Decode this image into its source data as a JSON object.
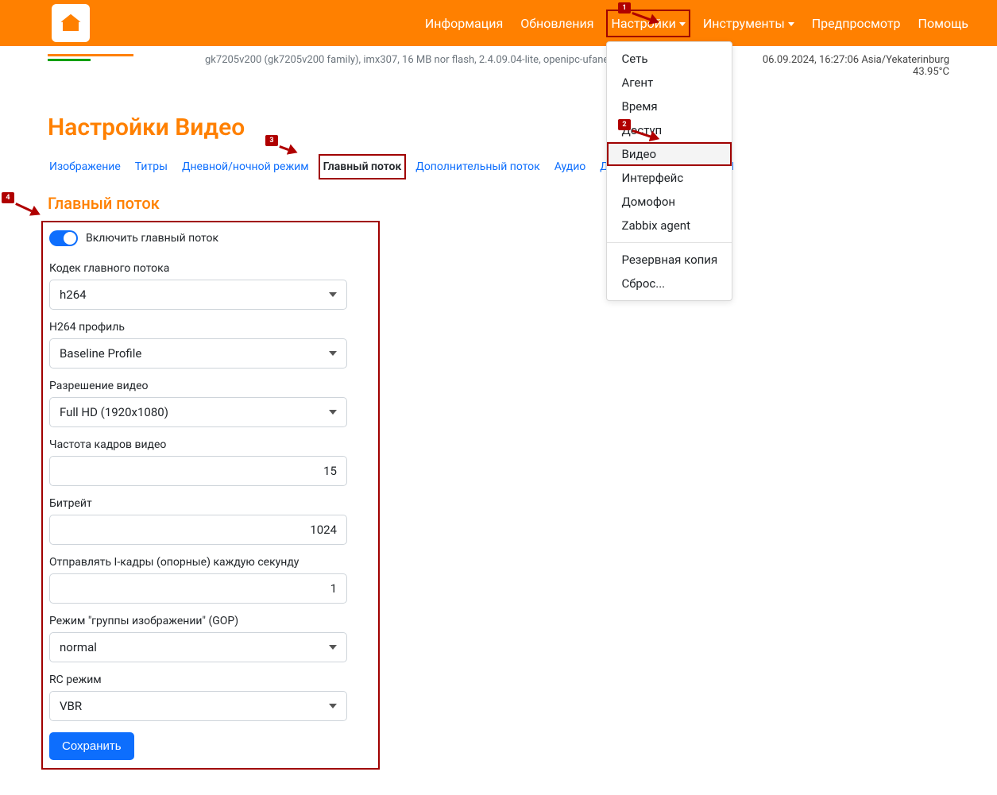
{
  "nav": {
    "items": [
      {
        "label": "Информация"
      },
      {
        "label": "Обновления"
      },
      {
        "label": "Настройки"
      },
      {
        "label": "Инструменты"
      },
      {
        "label": "Предпросмотр"
      },
      {
        "label": "Помощь"
      }
    ]
  },
  "dropdown": {
    "items": [
      "Сеть",
      "Агент",
      "Время",
      "Доступ",
      "Видео",
      "Интерфейс",
      "Домофон",
      "Zabbix agent"
    ],
    "footer_items": [
      "Резервная копия",
      "Сброс..."
    ]
  },
  "info": {
    "left": "gk7205v200 (gk7205v200 family), imx307, 16 MB nor flash, 2.4.09.04-lite, openipc-ufanet, 50:62:55:01:fe:",
    "right_date": "06.09.2024, 16:27:06 Asia/Yekaterinburg",
    "right_temp": "43.95°C"
  },
  "page": {
    "title": "Настройки Видео",
    "section_title": "Главный поток"
  },
  "tabs": [
    "Изображение",
    "Титры",
    "Дневной/ночной режим",
    "Главный поток",
    "Дополнительный поток",
    "Аудио",
    "Детектор движения",
    "ON"
  ],
  "form": {
    "enable_label": "Включить главный поток",
    "codec_label": "Кодек главного потока",
    "codec_value": "h264",
    "profile_label": "H264 профиль",
    "profile_value": "Baseline Profile",
    "resolution_label": "Разрешение видео",
    "resolution_value": "Full HD (1920x1080)",
    "fps_label": "Частота кадров видео",
    "fps_value": "15",
    "bitrate_label": "Битрейт",
    "bitrate_value": "1024",
    "iframe_label": "Отправлять I-кадры (опорные) каждую секунду",
    "iframe_value": "1",
    "gop_label": "Режим \"группы изображении\" (GOP)",
    "gop_value": "normal",
    "rc_label": "RC режим",
    "rc_value": "VBR",
    "save_label": "Сохранить"
  },
  "annotations": {
    "n1": "1",
    "n2": "2",
    "n3": "3",
    "n4": "4"
  }
}
